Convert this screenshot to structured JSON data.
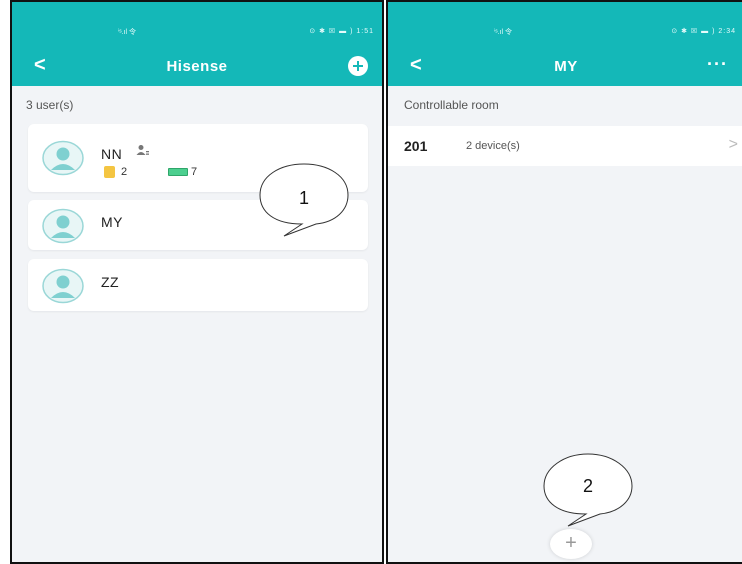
{
  "left": {
    "status": {
      "signal": "ⁱˢ.ıl 令",
      "right": "⊙ ✱ ☒ ▬ ) 1:51"
    },
    "header": {
      "back": "<",
      "title": "Hisense"
    },
    "user_count": "3 user(s)",
    "users": [
      {
        "name": "NN",
        "doors": "2",
        "cards": "7"
      },
      {
        "name": "MY"
      },
      {
        "name": "ZZ"
      }
    ],
    "callout": "1"
  },
  "right": {
    "status": {
      "signal": "ⁱˢ.ıl 令",
      "right": "⊙ ✱ ☒ ▬ ) 2:34"
    },
    "header": {
      "back": "<",
      "title": "MY",
      "more": "···"
    },
    "section": "Controllable room",
    "room": {
      "number": "201",
      "devices": "2 device(s)",
      "chevron": ">"
    },
    "callout": "2",
    "add": "+"
  },
  "colors": {
    "accent": "#14b8b8",
    "background": "#f2f4f7",
    "door": "#f4c542",
    "card": "#4ccf8f"
  }
}
